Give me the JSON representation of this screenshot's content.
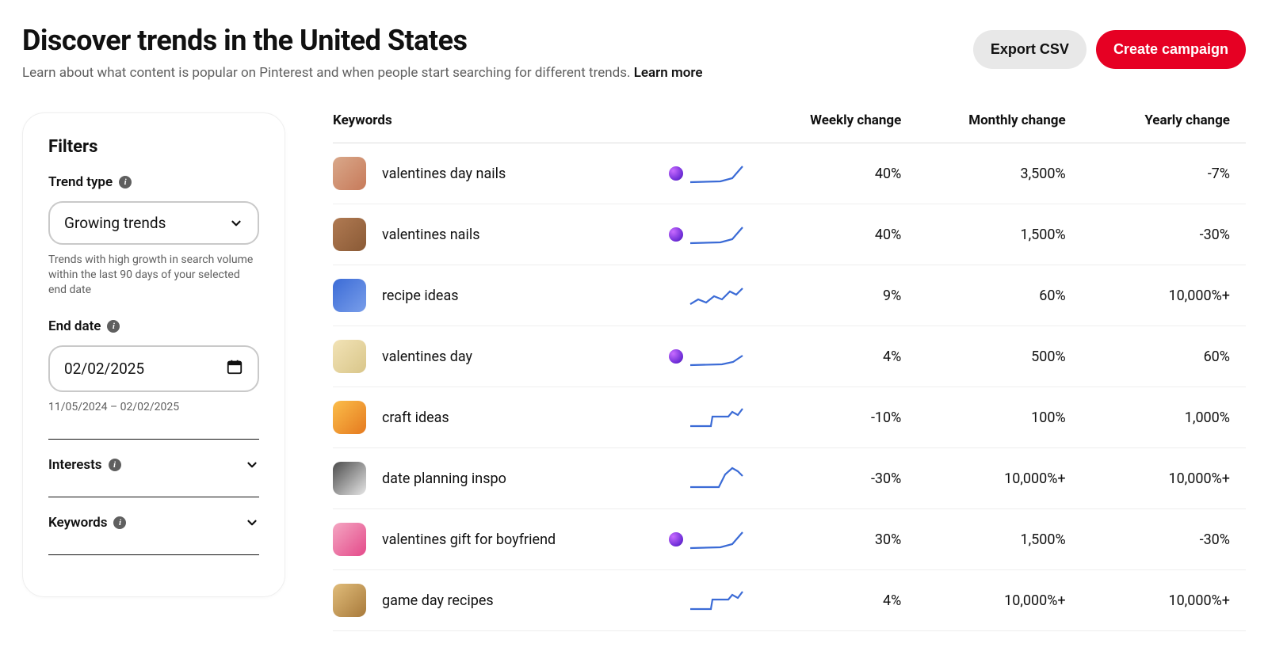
{
  "header": {
    "title": "Discover trends in the United States",
    "subtitle_prefix": "Learn about what content is popular on Pinterest and when people start searching for different trends. ",
    "learn_more": "Learn more",
    "export_label": "Export CSV",
    "campaign_label": "Create campaign"
  },
  "filters": {
    "panel_title": "Filters",
    "trend_type_label": "Trend type",
    "trend_type_value": "Growing trends",
    "trend_type_help": "Trends with high growth in search volume within the last 90 days of your selected end date",
    "end_date_label": "End date",
    "end_date_value": "02/02/2025",
    "date_range_help": "11/05/2024 – 02/02/2025",
    "interests_label": "Interests",
    "keywords_label": "Keywords"
  },
  "table": {
    "columns": {
      "keywords": "Keywords",
      "weekly": "Weekly change",
      "monthly": "Monthly change",
      "yearly": "Yearly change"
    },
    "rows": [
      {
        "keyword": "valentines day nails",
        "weekly": "40%",
        "monthly": "3,500%",
        "yearly": "-7%",
        "predict": true,
        "spark": "up",
        "thumb": "pinkish"
      },
      {
        "keyword": "valentines nails",
        "weekly": "40%",
        "monthly": "1,500%",
        "yearly": "-30%",
        "predict": true,
        "spark": "up",
        "thumb": "brown"
      },
      {
        "keyword": "recipe ideas",
        "weekly": "9%",
        "monthly": "60%",
        "yearly": "10,000%+",
        "predict": false,
        "spark": "wiggle",
        "thumb": "blue"
      },
      {
        "keyword": "valentines day",
        "weekly": "4%",
        "monthly": "500%",
        "yearly": "60%",
        "predict": true,
        "spark": "flatup",
        "thumb": "cream"
      },
      {
        "keyword": "craft ideas",
        "weekly": "-10%",
        "monthly": "100%",
        "yearly": "1,000%",
        "predict": false,
        "spark": "stepup",
        "thumb": "orange"
      },
      {
        "keyword": "date planning inspo",
        "weekly": "-30%",
        "monthly": "10,000%+",
        "yearly": "10,000%+",
        "predict": false,
        "spark": "spike",
        "thumb": "dark"
      },
      {
        "keyword": "valentines gift for boyfriend",
        "weekly": "30%",
        "monthly": "1,500%",
        "yearly": "-30%",
        "predict": true,
        "spark": "up",
        "thumb": "pink"
      },
      {
        "keyword": "game day recipes",
        "weekly": "4%",
        "monthly": "10,000%+",
        "yearly": "10,000%+",
        "predict": false,
        "spark": "stepup",
        "thumb": "tan"
      }
    ]
  }
}
